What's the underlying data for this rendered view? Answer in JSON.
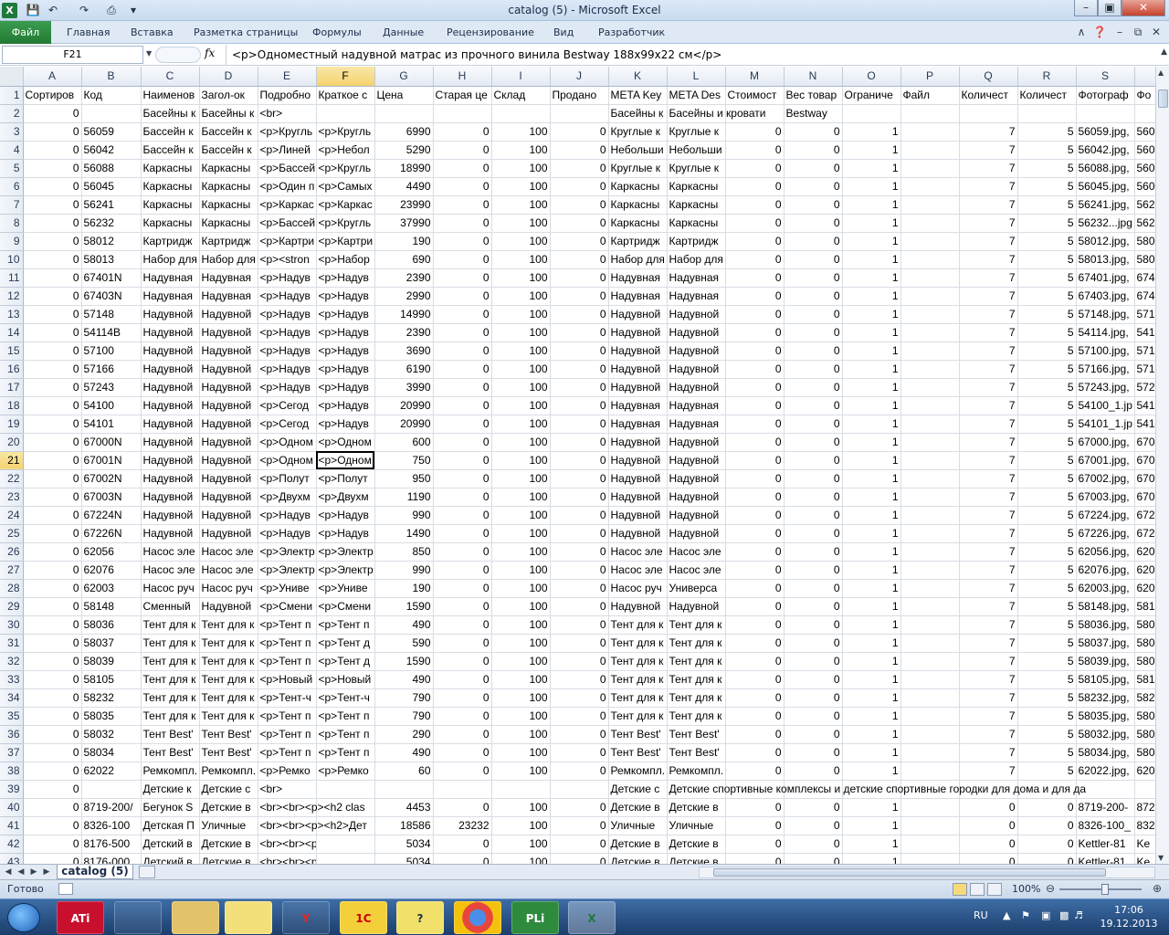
{
  "window": {
    "title": "catalog (5)  -  Microsoft Excel"
  },
  "ribbon": {
    "file": "Файл",
    "tabs": [
      "Главная",
      "Вставка",
      "Разметка страницы",
      "Формулы",
      "Данные",
      "Рецензирование",
      "Вид",
      "Разработчик"
    ]
  },
  "formula_bar": {
    "name_box": "F21",
    "fx": "fx",
    "value": "<p>Одноместный надувной матрас из прочного винила Bestway 188x99x22 см</p>"
  },
  "columns": [
    "A",
    "B",
    "C",
    "D",
    "E",
    "F",
    "G",
    "H",
    "I",
    "J",
    "K",
    "L",
    "M",
    "N",
    "O",
    "P",
    "Q",
    "R",
    "S",
    "T"
  ],
  "selected": {
    "row": 21,
    "col": "F"
  },
  "rows": [
    [
      "Сортиров",
      "Код",
      "Наименов",
      "Загол-ок",
      "Подробно",
      "Краткое с",
      "Цена",
      "Старая це",
      "Склад",
      "Продано",
      "META Key",
      "META Des",
      "Стоимост",
      "Вес товар",
      "Ограниче",
      "Файл",
      "Количест",
      "Количест",
      "Фотограф",
      "Фо"
    ],
    [
      "0",
      "",
      "Басейны к",
      "Басейны к",
      "<br>",
      "",
      "",
      "",
      "",
      "",
      "Басейны к",
      "Басейны и кровати",
      "",
      "Bestway",
      "",
      "",
      "",
      "",
      "",
      ""
    ],
    [
      "0",
      "56059",
      "Бассейн к",
      "Бассейн к",
      "<p>Кругль",
      "<p>Кругль",
      "6990",
      "0",
      "100",
      "0",
      "Круглые к",
      "Круглые к",
      "0",
      "0",
      "1",
      "",
      "7",
      "5",
      "56059.jpg,",
      "560"
    ],
    [
      "0",
      "56042",
      "Бассейн к",
      "Бассейн к",
      "<p>Линей",
      "<p>Небол",
      "5290",
      "0",
      "100",
      "0",
      "Небольши",
      "Небольши",
      "0",
      "0",
      "1",
      "",
      "7",
      "5",
      "56042.jpg,",
      "560"
    ],
    [
      "0",
      "56088",
      "Каркасны",
      "Каркасны",
      "<p>Бассей",
      "<p>Кругль",
      "18990",
      "0",
      "100",
      "0",
      "Круглые к",
      "Круглые к",
      "0",
      "0",
      "1",
      "",
      "7",
      "5",
      "56088.jpg,",
      "560"
    ],
    [
      "0",
      "56045",
      "Каркасны",
      "Каркасны",
      "<p>Один п",
      "<p>Самых",
      "4490",
      "0",
      "100",
      "0",
      "Каркасны",
      "Каркасны",
      "0",
      "0",
      "1",
      "",
      "7",
      "5",
      "56045.jpg,",
      "560"
    ],
    [
      "0",
      "56241",
      "Каркасны",
      "Каркасны",
      "<p>Каркас",
      "<p>Каркас",
      "23990",
      "0",
      "100",
      "0",
      "Каркасны",
      "Каркасны",
      "0",
      "0",
      "1",
      "",
      "7",
      "5",
      "56241.jpg,",
      "562"
    ],
    [
      "0",
      "56232",
      "Каркасны",
      "Каркасны",
      "<p>Бассей",
      "<p>Кругль",
      "37990",
      "0",
      "100",
      "0",
      "Каркасны",
      "Каркасны",
      "0",
      "0",
      "1",
      "",
      "7",
      "5",
      "56232...jpg",
      "562"
    ],
    [
      "0",
      "58012",
      "Картридж",
      "Картридж",
      "<p>Картри",
      "<p>Картри",
      "190",
      "0",
      "100",
      "0",
      "Картридж",
      "Картридж",
      "0",
      "0",
      "1",
      "",
      "7",
      "5",
      "58012.jpg,",
      "580"
    ],
    [
      "0",
      "58013",
      "Набор для",
      "Набор для",
      "<p><stron",
      "<p>Набор",
      "690",
      "0",
      "100",
      "0",
      "Набор для",
      "Набор для",
      "0",
      "0",
      "1",
      "",
      "7",
      "5",
      "58013.jpg,",
      "580"
    ],
    [
      "0",
      "67401N",
      "Надувная",
      "Надувная",
      "<p>Надув",
      "<p>Надув",
      "2390",
      "0",
      "100",
      "0",
      "Надувная",
      "Надувная",
      "0",
      "0",
      "1",
      "",
      "7",
      "5",
      "67401.jpg,",
      "674"
    ],
    [
      "0",
      "67403N",
      "Надувная",
      "Надувная",
      "<p>Надув",
      "<p>Надув",
      "2990",
      "0",
      "100",
      "0",
      "Надувная",
      "Надувная",
      "0",
      "0",
      "1",
      "",
      "7",
      "5",
      "67403.jpg,",
      "674"
    ],
    [
      "0",
      "57148",
      "Надувной",
      "Надувной",
      "<p>Надув",
      "<p>Надув",
      "14990",
      "0",
      "100",
      "0",
      "Надувной",
      "Надувной",
      "0",
      "0",
      "1",
      "",
      "7",
      "5",
      "57148.jpg,",
      "571"
    ],
    [
      "0",
      "54114B",
      "Надувной",
      "Надувной",
      "<p>Надув",
      "<p>Надув",
      "2390",
      "0",
      "100",
      "0",
      "Надувной",
      "Надувной",
      "0",
      "0",
      "1",
      "",
      "7",
      "5",
      "54114.jpg,",
      "541"
    ],
    [
      "0",
      "57100",
      "Надувной",
      "Надувной",
      "<p>Надув",
      "<p>Надув",
      "3690",
      "0",
      "100",
      "0",
      "Надувной",
      "Надувной",
      "0",
      "0",
      "1",
      "",
      "7",
      "5",
      "57100.jpg,",
      "571"
    ],
    [
      "0",
      "57166",
      "Надувной",
      "Надувной",
      "<p>Надув",
      "<p>Надув",
      "6190",
      "0",
      "100",
      "0",
      "Надувной",
      "Надувной",
      "0",
      "0",
      "1",
      "",
      "7",
      "5",
      "57166.jpg,",
      "571"
    ],
    [
      "0",
      "57243",
      "Надувной",
      "Надувной",
      "<p>Надув",
      "<p>Надув",
      "3990",
      "0",
      "100",
      "0",
      "Надувной",
      "Надувной",
      "0",
      "0",
      "1",
      "",
      "7",
      "5",
      "57243.jpg,",
      "572"
    ],
    [
      "0",
      "54100",
      "Надувной",
      "Надувной",
      "<p>Сегод",
      "<p>Надув",
      "20990",
      "0",
      "100",
      "0",
      "Надувная",
      "Надувная",
      "0",
      "0",
      "1",
      "",
      "7",
      "5",
      "54100_1.jp",
      "541"
    ],
    [
      "0",
      "54101",
      "Надувной",
      "Надувной",
      "<p>Сегод",
      "<p>Надув",
      "20990",
      "0",
      "100",
      "0",
      "Надувная",
      "Надувная",
      "0",
      "0",
      "1",
      "",
      "7",
      "5",
      "54101_1.jp",
      "541"
    ],
    [
      "0",
      "67000N",
      "Надувной",
      "Надувной",
      "<p>Одном",
      "<p>Одном",
      "600",
      "0",
      "100",
      "0",
      "Надувной",
      "Надувной",
      "0",
      "0",
      "1",
      "",
      "7",
      "5",
      "67000.jpg,",
      "670"
    ],
    [
      "0",
      "67001N",
      "Надувной",
      "Надувной",
      "<p>Одном",
      "<p>Одном",
      "750",
      "0",
      "100",
      "0",
      "Надувной",
      "Надувной",
      "0",
      "0",
      "1",
      "",
      "7",
      "5",
      "67001.jpg,",
      "670"
    ],
    [
      "0",
      "67002N",
      "Надувной",
      "Надувной",
      "<p>Полут",
      "<p>Полут",
      "950",
      "0",
      "100",
      "0",
      "Надувной",
      "Надувной",
      "0",
      "0",
      "1",
      "",
      "7",
      "5",
      "67002.jpg,",
      "670"
    ],
    [
      "0",
      "67003N",
      "Надувной",
      "Надувной",
      "<p>Двухм",
      "<p>Двухм",
      "1190",
      "0",
      "100",
      "0",
      "Надувной",
      "Надувной",
      "0",
      "0",
      "1",
      "",
      "7",
      "5",
      "67003.jpg,",
      "670"
    ],
    [
      "0",
      "67224N",
      "Надувной",
      "Надувной",
      "<p>Надув",
      "<p>Надув",
      "990",
      "0",
      "100",
      "0",
      "Надувной",
      "Надувной",
      "0",
      "0",
      "1",
      "",
      "7",
      "5",
      "67224.jpg,",
      "672"
    ],
    [
      "0",
      "67226N",
      "Надувной",
      "Надувной",
      "<p>Надув",
      "<p>Надув",
      "1490",
      "0",
      "100",
      "0",
      "Надувной",
      "Надувной",
      "0",
      "0",
      "1",
      "",
      "7",
      "5",
      "67226.jpg,",
      "672"
    ],
    [
      "0",
      "62056",
      "Насос эле",
      "Насос эле",
      "<p>Электр",
      "<p>Электр",
      "850",
      "0",
      "100",
      "0",
      "Насос эле",
      "Насос эле",
      "0",
      "0",
      "1",
      "",
      "7",
      "5",
      "62056.jpg,",
      "620"
    ],
    [
      "0",
      "62076",
      "Насос эле",
      "Насос эле",
      "<p>Электр",
      "<p>Электр",
      "990",
      "0",
      "100",
      "0",
      "Насос эле",
      "Насос эле",
      "0",
      "0",
      "1",
      "",
      "7",
      "5",
      "62076.jpg,",
      "620"
    ],
    [
      "0",
      "62003",
      "Насос руч",
      "Насос руч",
      "<p>Униве",
      "<p>Униве",
      "190",
      "0",
      "100",
      "0",
      "Насос руч",
      "Универса",
      "0",
      "0",
      "1",
      "",
      "7",
      "5",
      "62003.jpg,",
      "620"
    ],
    [
      "0",
      "58148",
      "Сменный",
      "Надувной",
      "<p>Смени",
      "<p>Смени",
      "1590",
      "0",
      "100",
      "0",
      "Надувной",
      "Надувной",
      "0",
      "0",
      "1",
      "",
      "7",
      "5",
      "58148.jpg,",
      "581"
    ],
    [
      "0",
      "58036",
      "Тент для к",
      "Тент для к",
      "<p>Тент п",
      "<p>Тент п",
      "490",
      "0",
      "100",
      "0",
      "Тент для к",
      "Тент для к",
      "0",
      "0",
      "1",
      "",
      "7",
      "5",
      "58036.jpg,",
      "580"
    ],
    [
      "0",
      "58037",
      "Тент для к",
      "Тент для к",
      "<p>Тент п",
      "<p>Тент д",
      "590",
      "0",
      "100",
      "0",
      "Тент для к",
      "Тент для к",
      "0",
      "0",
      "1",
      "",
      "7",
      "5",
      "58037.jpg,",
      "580"
    ],
    [
      "0",
      "58039",
      "Тент для к",
      "Тент для к",
      "<p>Тент п",
      "<p>Тент д",
      "1590",
      "0",
      "100",
      "0",
      "Тент для к",
      "Тент для к",
      "0",
      "0",
      "1",
      "",
      "7",
      "5",
      "58039.jpg,",
      "580"
    ],
    [
      "0",
      "58105",
      "Тент для к",
      "Тент для к",
      "<p>Новый",
      "<p>Новый",
      "490",
      "0",
      "100",
      "0",
      "Тент для к",
      "Тент для к",
      "0",
      "0",
      "1",
      "",
      "7",
      "5",
      "58105.jpg,",
      "581"
    ],
    [
      "0",
      "58232",
      "Тент для к",
      "Тент для к",
      "<p>Тент-ч",
      "<p>Тент-ч",
      "790",
      "0",
      "100",
      "0",
      "Тент для к",
      "Тент для к",
      "0",
      "0",
      "1",
      "",
      "7",
      "5",
      "58232.jpg,",
      "582"
    ],
    [
      "0",
      "58035",
      "Тент для к",
      "Тент для к",
      "<p>Тент п",
      "<p>Тент п",
      "790",
      "0",
      "100",
      "0",
      "Тент для к",
      "Тент для к",
      "0",
      "0",
      "1",
      "",
      "7",
      "5",
      "58035.jpg,",
      "580"
    ],
    [
      "0",
      "58032",
      "Тент Best'",
      "Тент Best'",
      "<p>Тент п",
      "<p>Тент п",
      "290",
      "0",
      "100",
      "0",
      "Тент Best'",
      "Тент Best'",
      "0",
      "0",
      "1",
      "",
      "7",
      "5",
      "58032.jpg,",
      "580"
    ],
    [
      "0",
      "58034",
      "Тент Best'",
      "Тент Best'",
      "<p>Тент п",
      "<p>Тент п",
      "490",
      "0",
      "100",
      "0",
      "Тент Best'",
      "Тент Best'",
      "0",
      "0",
      "1",
      "",
      "7",
      "5",
      "58034.jpg,",
      "580"
    ],
    [
      "0",
      "62022",
      "Ремкомпл.",
      "Ремкомпл.",
      "<p>Ремко",
      "<p>Ремко",
      "60",
      "0",
      "100",
      "0",
      "Ремкомпл.",
      "Ремкомпл.",
      "0",
      "0",
      "1",
      "",
      "7",
      "5",
      "62022.jpg,",
      "620"
    ],
    [
      "0",
      "",
      "Детские к",
      "Детские с",
      "<br>",
      "",
      "",
      "",
      "",
      "",
      "Детские с",
      "Детские спортивные комплексы  и детские спортивные городки для дома и для да",
      "",
      "",
      "",
      "",
      "",
      "",
      "",
      ""
    ],
    [
      "0",
      "8719-200/",
      "Бегунок S",
      "Детские в",
      "<br><br><p><h2 clas",
      "",
      "4453",
      "0",
      "100",
      "0",
      "Детские в",
      "Детские в",
      "0",
      "0",
      "1",
      "",
      "0",
      "0",
      "8719-200-",
      "872"
    ],
    [
      "0",
      "8326-100",
      "Детская П",
      "Уличные",
      "<br><br><p><h2>Дет",
      "",
      "18586",
      "23232",
      "100",
      "0",
      "Уличные",
      "Уличные",
      "0",
      "0",
      "1",
      "",
      "0",
      "0",
      "8326-100_",
      "832"
    ],
    [
      "0",
      "8176-500",
      "Детский в",
      "Детские в",
      "<br><br><p>- вы",
      "",
      "5034",
      "0",
      "100",
      "0",
      "Детские в",
      "Детские в",
      "0",
      "0",
      "1",
      "",
      "0",
      "0",
      "Kettler-81",
      "Ke"
    ],
    [
      "0",
      "8176-000",
      "Детский в",
      "Детские в",
      "<br><br><p>- вы",
      "",
      "5034",
      "0",
      "100",
      "0",
      "Детские в",
      "Детские в",
      "0",
      "0",
      "1",
      "",
      "0",
      "0",
      "Kettler-81",
      "Ke"
    ]
  ],
  "sheet": {
    "tab": "catalog (5)"
  },
  "status": {
    "ready": "Готово",
    "zoom": "100%"
  },
  "taskbar": {
    "apps": [
      "ATi",
      "",
      "",
      "",
      "Y",
      "1С",
      "?",
      "",
      "PLi",
      "X"
    ],
    "lang": "RU",
    "time": "17:06",
    "date": "19.12.2013"
  }
}
